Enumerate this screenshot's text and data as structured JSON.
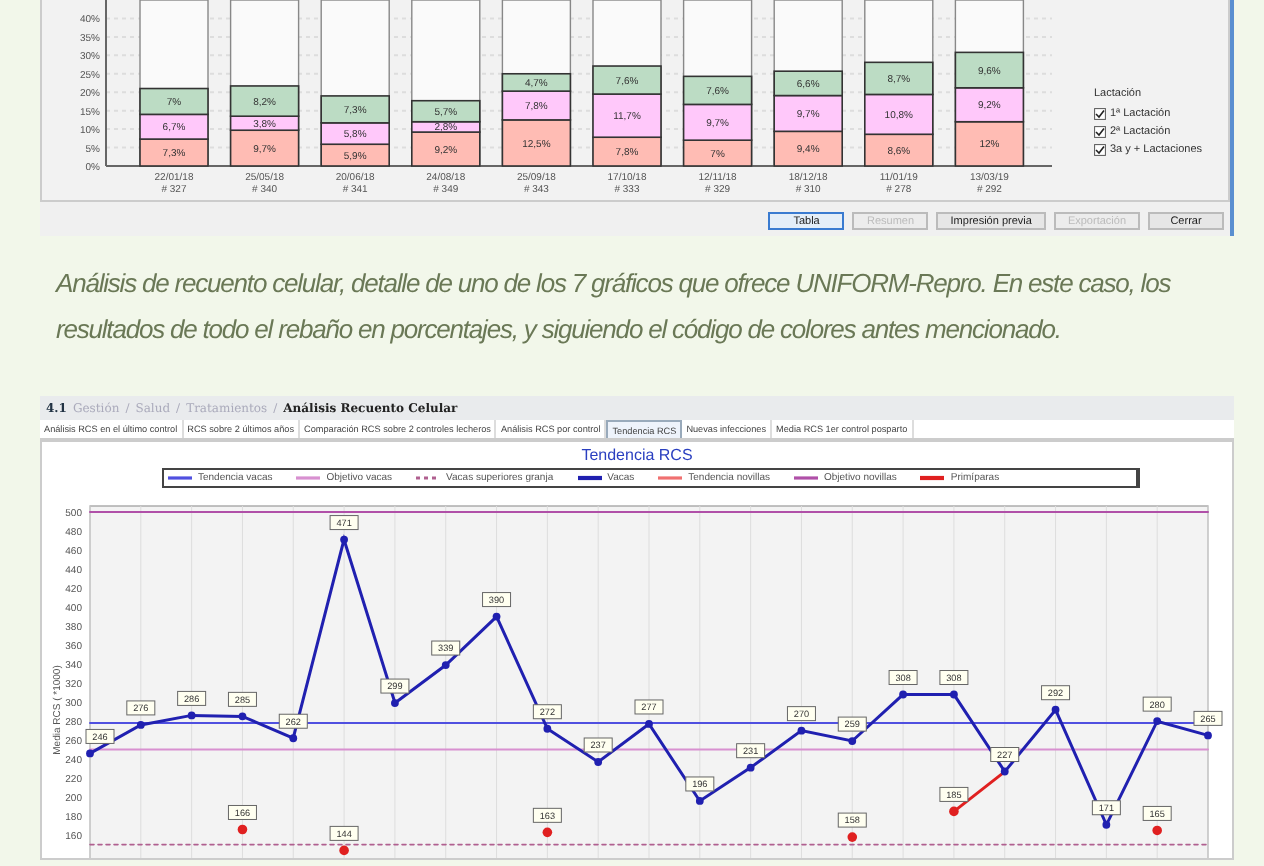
{
  "top_window": {
    "chart_data": {
      "type": "bar",
      "stacked": true,
      "grid": true,
      "ylim": [
        0,
        45
      ],
      "categories": [
        "22/01/18\n# 327",
        "25/05/18\n# 340",
        "20/06/18\n# 341",
        "24/08/18\n# 349",
        "25/09/18\n# 343",
        "17/10/18\n# 333",
        "12/11/18\n# 329",
        "18/12/18\n# 310",
        "11/01/19\n# 278",
        "13/03/19\n# 292"
      ],
      "yticks": [
        {
          "value": 0,
          "label": "0%"
        },
        {
          "value": 5,
          "label": "5%"
        },
        {
          "value": 10,
          "label": "10%"
        },
        {
          "value": 15,
          "label": "15%"
        },
        {
          "value": 20,
          "label": "20%"
        },
        {
          "value": 25,
          "label": "25%"
        },
        {
          "value": 30,
          "label": "30%"
        },
        {
          "value": 35,
          "label": "35%"
        },
        {
          "value": 40,
          "label": "40%"
        }
      ],
      "series": [
        {
          "color": "#ffbcb4",
          "values": [
            7.3,
            9.7,
            5.9,
            9.2,
            12.5,
            7.8,
            7,
            9.4,
            8.6,
            12
          ]
        },
        {
          "color": "#ffc8fa",
          "values": [
            6.7,
            3.8,
            5.8,
            2.8,
            7.8,
            11.7,
            9.7,
            9.7,
            10.8,
            9.2
          ]
        },
        {
          "color": "#bcdcc4",
          "values": [
            7,
            8.2,
            7.3,
            5.7,
            4.7,
            7.6,
            7.6,
            6.6,
            8.7,
            9.6
          ]
        }
      ],
      "value_labels": [
        [
          "7,3%",
          "9,7%",
          "5,9%",
          "9,2%",
          "12,5%",
          "7,8%",
          "7%",
          "9,4%",
          "8,6%",
          "12%"
        ],
        [
          "6,7%",
          "3,8%",
          "5,8%",
          "2,8%",
          "7,8%",
          "11,7%",
          "9,7%",
          "9,7%",
          "10,8%",
          "9,2%"
        ],
        [
          "7%",
          "8,2%",
          "7,3%",
          "5,7%",
          "4,7%",
          "7,6%",
          "7,6%",
          "6,6%",
          "8,7%",
          "9,6%"
        ]
      ]
    },
    "legend": {
      "title": "Lactación",
      "items": [
        {
          "label": "1ª Lactación",
          "checked": true
        },
        {
          "label": "2ª Lactación",
          "checked": true
        },
        {
          "label": "3a y + Lactaciones",
          "checked": true
        }
      ]
    },
    "buttons": [
      {
        "label": "Tabla",
        "disabled": false,
        "focused": true
      },
      {
        "label": "Resumen",
        "disabled": true,
        "focused": false
      },
      {
        "label": "Impresión previa",
        "disabled": false,
        "focused": false
      },
      {
        "label": "Exportación",
        "disabled": true,
        "focused": false
      },
      {
        "label": "Cerrar",
        "disabled": false,
        "focused": false
      }
    ]
  },
  "caption": "Análisis de recuento celular, detalle de uno de los 7 gráficos que ofrece UNIFORM-Repro. En este caso, los resultados de todo el rebaño en porcentajes, y siguiendo el código de colores antes mencionado.",
  "bottom_window": {
    "breadcrumb": {
      "number": "4.1",
      "path": [
        "Gestión",
        "Salud",
        "Tratamientos"
      ],
      "separator": "/",
      "current": "Análisis Recuento Celular"
    },
    "tabs": [
      {
        "label": "Análisis RCS en el último control",
        "selected": false
      },
      {
        "label": "RCS sobre 2 últimos años",
        "selected": false
      },
      {
        "label": "Comparación RCS sobre 2 controles lecheros",
        "selected": false
      },
      {
        "label": "Análisis RCS por control",
        "selected": false
      },
      {
        "label": "Tendencia RCS",
        "selected": true
      },
      {
        "label": "Nuevas infecciones",
        "selected": false
      },
      {
        "label": "Media RCS 1er control posparto",
        "selected": false
      }
    ],
    "chart_data": {
      "type": "line",
      "title": "Tendencia RCS",
      "ylabel": "Media RCS ( *1000)",
      "grid": true,
      "ylim": [
        136,
        500
      ],
      "yticks": [
        160,
        180,
        200,
        220,
        240,
        260,
        280,
        300,
        320,
        340,
        360,
        380,
        400,
        420,
        440,
        460,
        480,
        500
      ],
      "series": [
        {
          "name": "Tendencia vacas",
          "color": "#5050e0",
          "line_style": "solid",
          "marker": "none",
          "values": [
            278,
            278,
            278,
            278,
            278,
            278,
            278,
            278,
            278,
            278,
            278,
            278,
            278,
            278,
            278,
            278,
            278,
            278,
            278,
            278,
            278,
            278,
            278
          ]
        },
        {
          "name": "Objetivo vacas",
          "color": "#d890d0",
          "line_style": "solid",
          "marker": "none",
          "values": [
            250,
            250,
            250,
            250,
            250,
            250,
            250,
            250,
            250,
            250,
            250,
            250,
            250,
            250,
            250,
            250,
            250,
            250,
            250,
            250,
            250,
            250,
            250
          ]
        },
        {
          "name": "Vacas superiores granja",
          "color": "#b06090",
          "line_style": "dotted",
          "marker": "none",
          "values": [
            150,
            150,
            150,
            150,
            150,
            150,
            150,
            150,
            150,
            150,
            150,
            150,
            150,
            150,
            150,
            150,
            150,
            150,
            150,
            150,
            150,
            150,
            150
          ]
        },
        {
          "name": "Vacas",
          "color": "#2020b0",
          "line_style": "solid",
          "marker": "circle",
          "values": [
            246,
            276,
            286,
            285,
            262,
            471,
            299,
            339,
            390,
            272,
            237,
            277,
            196,
            231,
            270,
            259,
            308,
            308,
            227,
            292,
            171,
            280,
            265
          ]
        },
        {
          "name": "Tendencia novillas",
          "color": "#f07070",
          "line_style": "solid",
          "marker": "none",
          "values": [
            null,
            null,
            null,
            null,
            null,
            null,
            null,
            null,
            null,
            null,
            null,
            null,
            null,
            null,
            null,
            null,
            null,
            null,
            null,
            null,
            null,
            null,
            null
          ]
        },
        {
          "name": "Objetivo novillas",
          "color": "#b050a8",
          "line_style": "solid",
          "marker": "none",
          "values": [
            500,
            500,
            500,
            500,
            500,
            500,
            500,
            500,
            500,
            500,
            500,
            500,
            500,
            500,
            500,
            500,
            500,
            500,
            500,
            500,
            500,
            500,
            500
          ]
        },
        {
          "name": "Primíparas",
          "color": "#e02020",
          "line_style": "solid",
          "marker": "circle",
          "values": [
            null,
            null,
            null,
            166,
            null,
            144,
            null,
            null,
            null,
            163,
            null,
            null,
            null,
            null,
            null,
            158,
            null,
            185,
            227,
            null,
            null,
            165,
            null
          ]
        }
      ],
      "value_labels": [
        null,
        null,
        null,
        [
          "246",
          "276",
          "286",
          "285",
          "262",
          "471",
          "299",
          "339",
          "390",
          "272",
          "237",
          "277",
          "196",
          "231",
          "270",
          "259",
          "308",
          "308",
          "227",
          "292",
          "171",
          "280",
          "265"
        ],
        null,
        null,
        [
          null,
          null,
          null,
          "166",
          null,
          "144",
          null,
          null,
          null,
          "163",
          null,
          null,
          null,
          null,
          null,
          "158",
          null,
          "185",
          null,
          null,
          null,
          "165",
          null
        ]
      ]
    }
  }
}
